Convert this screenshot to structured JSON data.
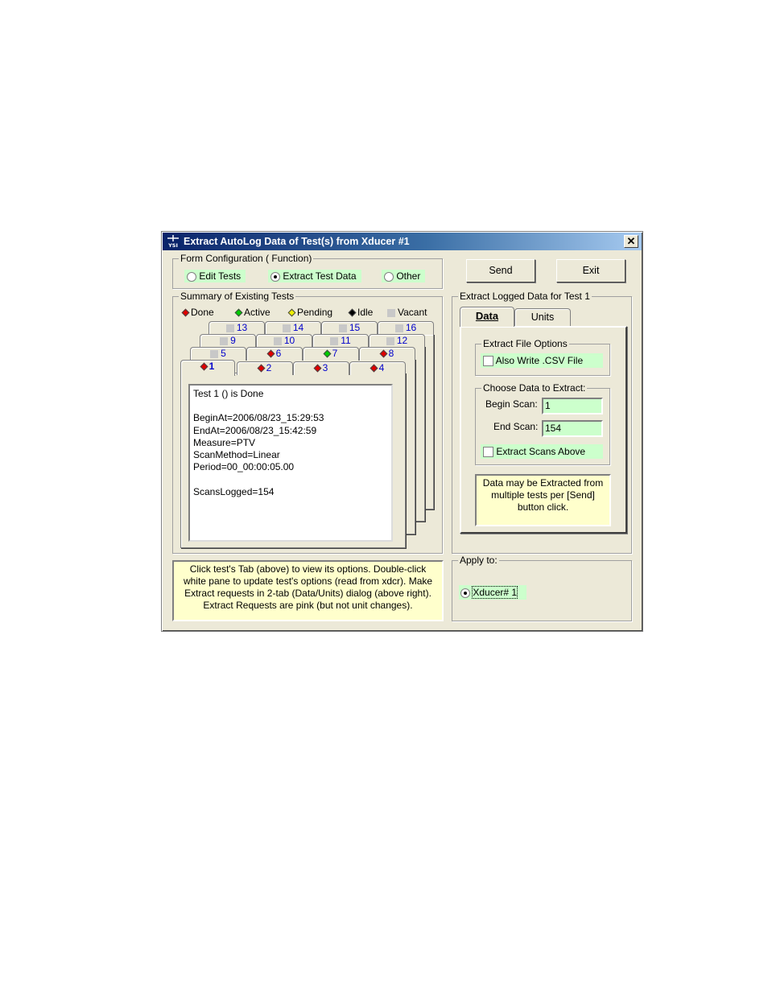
{
  "window": {
    "title": "Extract AutoLog Data of Test(s) from Xducer #1",
    "icon_label": "YSI",
    "close": "✕"
  },
  "form_config": {
    "legend": "Form Configuration ( Function)",
    "options": [
      {
        "label": "Edit Tests",
        "selected": false
      },
      {
        "label": "Extract Test Data",
        "selected": true
      },
      {
        "label": "Other",
        "selected": false
      }
    ]
  },
  "buttons": {
    "send": "Send",
    "exit": "Exit"
  },
  "summary": {
    "legend": "Summary of Existing Tests",
    "status_legend": [
      {
        "label": "Done",
        "color": "#e00000"
      },
      {
        "label": "Active",
        "color": "#00cc00"
      },
      {
        "label": "Pending",
        "color": "#eeee00"
      },
      {
        "label": "Idle",
        "color": "#000000"
      },
      {
        "label": "Vacant",
        "color": "#c8c8c8"
      }
    ],
    "tab_rows": [
      [
        {
          "label": "13",
          "status": "vacant"
        },
        {
          "label": "14",
          "status": "vacant"
        },
        {
          "label": "15",
          "status": "vacant"
        },
        {
          "label": "16",
          "status": "vacant"
        }
      ],
      [
        {
          "label": "9",
          "status": "vacant"
        },
        {
          "label": "10",
          "status": "vacant"
        },
        {
          "label": "11",
          "status": "vacant"
        },
        {
          "label": "12",
          "status": "vacant"
        }
      ],
      [
        {
          "label": "5",
          "status": "vacant"
        },
        {
          "label": "6",
          "status": "done"
        },
        {
          "label": "7",
          "status": "active"
        },
        {
          "label": "8",
          "status": "done"
        }
      ],
      [
        {
          "label": "1",
          "status": "done"
        },
        {
          "label": "2",
          "status": "done"
        },
        {
          "label": "3",
          "status": "done"
        },
        {
          "label": "4",
          "status": "done"
        }
      ]
    ],
    "details": [
      "Test 1 () is Done",
      "",
      "BeginAt=2006/08/23_15:29:53",
      "EndAt=2006/08/23_15:42:59",
      "Measure=PTV",
      "ScanMethod=Linear",
      "Period=00_00:00:05.00",
      "",
      "ScansLogged=154"
    ]
  },
  "help_text": [
    "Click test's Tab (above) to view its options.  Double-click",
    "white pane to update test's options (read from xdcr).  Make",
    "Extract requests in 2-tab (Data/Units) dialog (above right).",
    "Extract Requests are pink (but not unit changes)."
  ],
  "extract": {
    "legend": "Extract Logged Data for Test 1",
    "tabs": [
      {
        "label": "Data",
        "active": true
      },
      {
        "label": "Units",
        "active": false
      }
    ],
    "file_options": {
      "legend": "Extract File Options",
      "csv_label": "Also Write .CSV File",
      "csv_checked": false
    },
    "choose": {
      "legend": "Choose Data to Extract:",
      "begin_label": "Begin Scan:",
      "begin_value": "1",
      "end_label": "End Scan:",
      "end_value": "154",
      "above_label": "Extract Scans Above",
      "above_checked": false
    },
    "note": [
      "Data may be Extracted from",
      "multiple tests per [Send]",
      "button click."
    ]
  },
  "apply_to": {
    "legend": "Apply to:",
    "option": "Xducer# 1",
    "selected": true
  }
}
